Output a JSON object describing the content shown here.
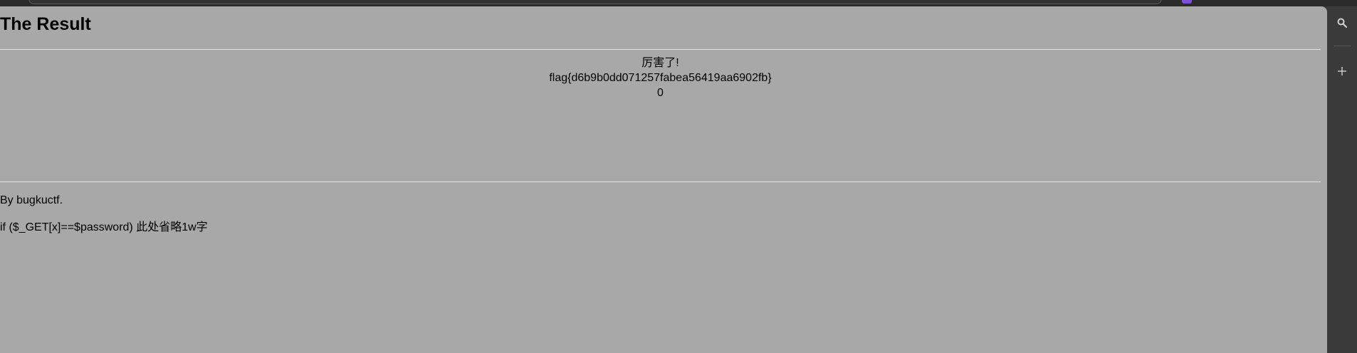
{
  "page": {
    "title": "The Result",
    "result_lines": [
      "厉害了!",
      "flag{d6b9b0dd071257fabea56419aa6902fb}",
      "0"
    ],
    "footer": {
      "author": "By bugkuctf.",
      "hint": "if ($_GET[x]==$password) 此处省略1w字"
    }
  },
  "side_panel": {
    "items": [
      {
        "icon": "search-icon"
      },
      {
        "icon": "plus-icon"
      }
    ]
  },
  "colors": {
    "page_background": "#a8a8a8",
    "chrome_background": "#3a3a3a",
    "rule": "#e4e4e4",
    "extension_accent": "#7b4fd6"
  }
}
